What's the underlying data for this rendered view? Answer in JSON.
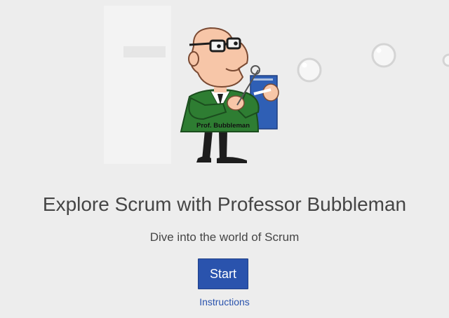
{
  "hero": {
    "badge_text": "Prof. Bubbleman"
  },
  "main": {
    "title": "Explore Scrum with Professor Bubbleman",
    "subtitle": "Dive into the world of Scrum",
    "start_label": "Start",
    "instructions_label": "Instructions"
  },
  "colors": {
    "background": "#ededed",
    "primary_button": "#2a53ad",
    "link": "#2a53ad",
    "text": "#454545",
    "jacket": "#2e7d32",
    "clipboard": "#2f5fb5"
  },
  "icons": [
    "professor-bubbleman-illustration",
    "bubble-icon"
  ]
}
